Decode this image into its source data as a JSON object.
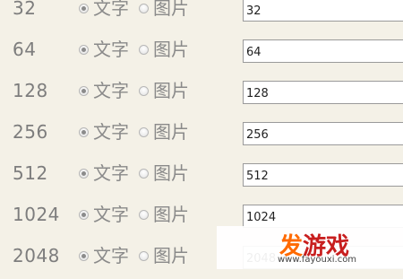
{
  "rows": [
    {
      "size": "32",
      "text_option": "文字",
      "image_option": "图片",
      "selected": "text",
      "value": "32"
    },
    {
      "size": "64",
      "text_option": "文字",
      "image_option": "图片",
      "selected": "text",
      "value": "64"
    },
    {
      "size": "128",
      "text_option": "文字",
      "image_option": "图片",
      "selected": "text",
      "value": "128"
    },
    {
      "size": "256",
      "text_option": "文字",
      "image_option": "图片",
      "selected": "text",
      "value": "256"
    },
    {
      "size": "512",
      "text_option": "文字",
      "image_option": "图片",
      "selected": "text",
      "value": "512"
    },
    {
      "size": "1024",
      "text_option": "文字",
      "image_option": "图片",
      "selected": "text",
      "value": "1024"
    },
    {
      "size": "2048",
      "text_option": "文字",
      "image_option": "图片",
      "selected": "text",
      "value": "2048"
    }
  ],
  "watermark": {
    "logo_first": "发",
    "logo_rest": "游戏",
    "url": "www.fayouxi.com"
  }
}
